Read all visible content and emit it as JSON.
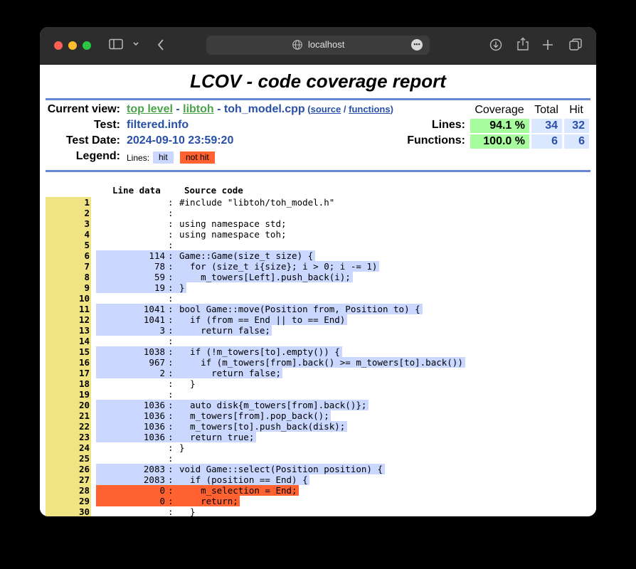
{
  "browser": {
    "url": "localhost"
  },
  "page": {
    "title": "LCOV - code coverage report",
    "current_view_label": "Current view:",
    "breadcrumb": {
      "top_level": "top level",
      "sep1": " - ",
      "dir": "libtoh",
      "sep2": " - ",
      "file": "toh_model.cpp",
      "open_paren": " (",
      "source": "source",
      "slash": " / ",
      "functions": "functions",
      "close_paren": ")"
    },
    "test_label": "Test:",
    "test_value": "filtered.info",
    "date_label": "Test Date:",
    "date_value": "2024-09-10 23:59:20",
    "legend_label": "Legend:",
    "legend_lines": "Lines:",
    "legend_hit": "hit",
    "legend_not_hit": "not hit",
    "colors": {
      "hit": "#cad7fe",
      "not_hit": "#ff6230",
      "line_no_bg": "#efe383",
      "coverage_good": "#a7fc9d",
      "rule": "#6688d4"
    }
  },
  "summary": {
    "headers": {
      "coverage": "Coverage",
      "total": "Total",
      "hit": "Hit"
    },
    "lines": {
      "label": "Lines:",
      "coverage": "94.1 %",
      "total": "34",
      "hit": "32"
    },
    "functions": {
      "label": "Functions:",
      "coverage": "100.0 %",
      "total": "6",
      "hit": "6"
    }
  },
  "code": {
    "header_line_data": "Line data",
    "header_source": "Source code",
    "lines": [
      {
        "n": "1",
        "count": "",
        "status": "none",
        "src": "#include \"libtoh/toh_model.h\""
      },
      {
        "n": "2",
        "count": "",
        "status": "none",
        "src": ""
      },
      {
        "n": "3",
        "count": "",
        "status": "none",
        "src": "using namespace std;"
      },
      {
        "n": "4",
        "count": "",
        "status": "none",
        "src": "using namespace toh;"
      },
      {
        "n": "5",
        "count": "",
        "status": "none",
        "src": ""
      },
      {
        "n": "6",
        "count": "114",
        "status": "hit",
        "src": "Game::Game(size_t size) {"
      },
      {
        "n": "7",
        "count": "78",
        "status": "hit",
        "src": "  for (size_t i{size}; i > 0; i -= 1)"
      },
      {
        "n": "8",
        "count": "59",
        "status": "hit",
        "src": "    m_towers[Left].push_back(i);"
      },
      {
        "n": "9",
        "count": "19",
        "status": "hit",
        "src": "}"
      },
      {
        "n": "10",
        "count": "",
        "status": "none",
        "src": ""
      },
      {
        "n": "11",
        "count": "1041",
        "status": "hit",
        "src": "bool Game::move(Position from, Position to) {"
      },
      {
        "n": "12",
        "count": "1041",
        "status": "hit",
        "src": "  if (from == End || to == End)"
      },
      {
        "n": "13",
        "count": "3",
        "status": "hit",
        "src": "    return false;"
      },
      {
        "n": "14",
        "count": "",
        "status": "none",
        "src": ""
      },
      {
        "n": "15",
        "count": "1038",
        "status": "hit",
        "src": "  if (!m_towers[to].empty()) {"
      },
      {
        "n": "16",
        "count": "967",
        "status": "hit",
        "src": "    if (m_towers[from].back() >= m_towers[to].back())"
      },
      {
        "n": "17",
        "count": "2",
        "status": "hit",
        "src": "      return false;"
      },
      {
        "n": "18",
        "count": "",
        "status": "none",
        "src": "  }"
      },
      {
        "n": "19",
        "count": "",
        "status": "none",
        "src": ""
      },
      {
        "n": "20",
        "count": "1036",
        "status": "hit",
        "src": "  auto disk{m_towers[from].back()};"
      },
      {
        "n": "21",
        "count": "1036",
        "status": "hit",
        "src": "  m_towers[from].pop_back();"
      },
      {
        "n": "22",
        "count": "1036",
        "status": "hit",
        "src": "  m_towers[to].push_back(disk);"
      },
      {
        "n": "23",
        "count": "1036",
        "status": "hit",
        "src": "  return true;"
      },
      {
        "n": "24",
        "count": "",
        "status": "none",
        "src": "}"
      },
      {
        "n": "25",
        "count": "",
        "status": "none",
        "src": ""
      },
      {
        "n": "26",
        "count": "2083",
        "status": "hit",
        "src": "void Game::select(Position position) {"
      },
      {
        "n": "27",
        "count": "2083",
        "status": "hit",
        "src": "  if (position == End) {"
      },
      {
        "n": "28",
        "count": "0",
        "status": "miss",
        "src": "    m_selection = End;"
      },
      {
        "n": "29",
        "count": "0",
        "status": "miss",
        "src": "    return;"
      },
      {
        "n": "30",
        "count": "",
        "status": "none",
        "src": "  }"
      }
    ]
  }
}
